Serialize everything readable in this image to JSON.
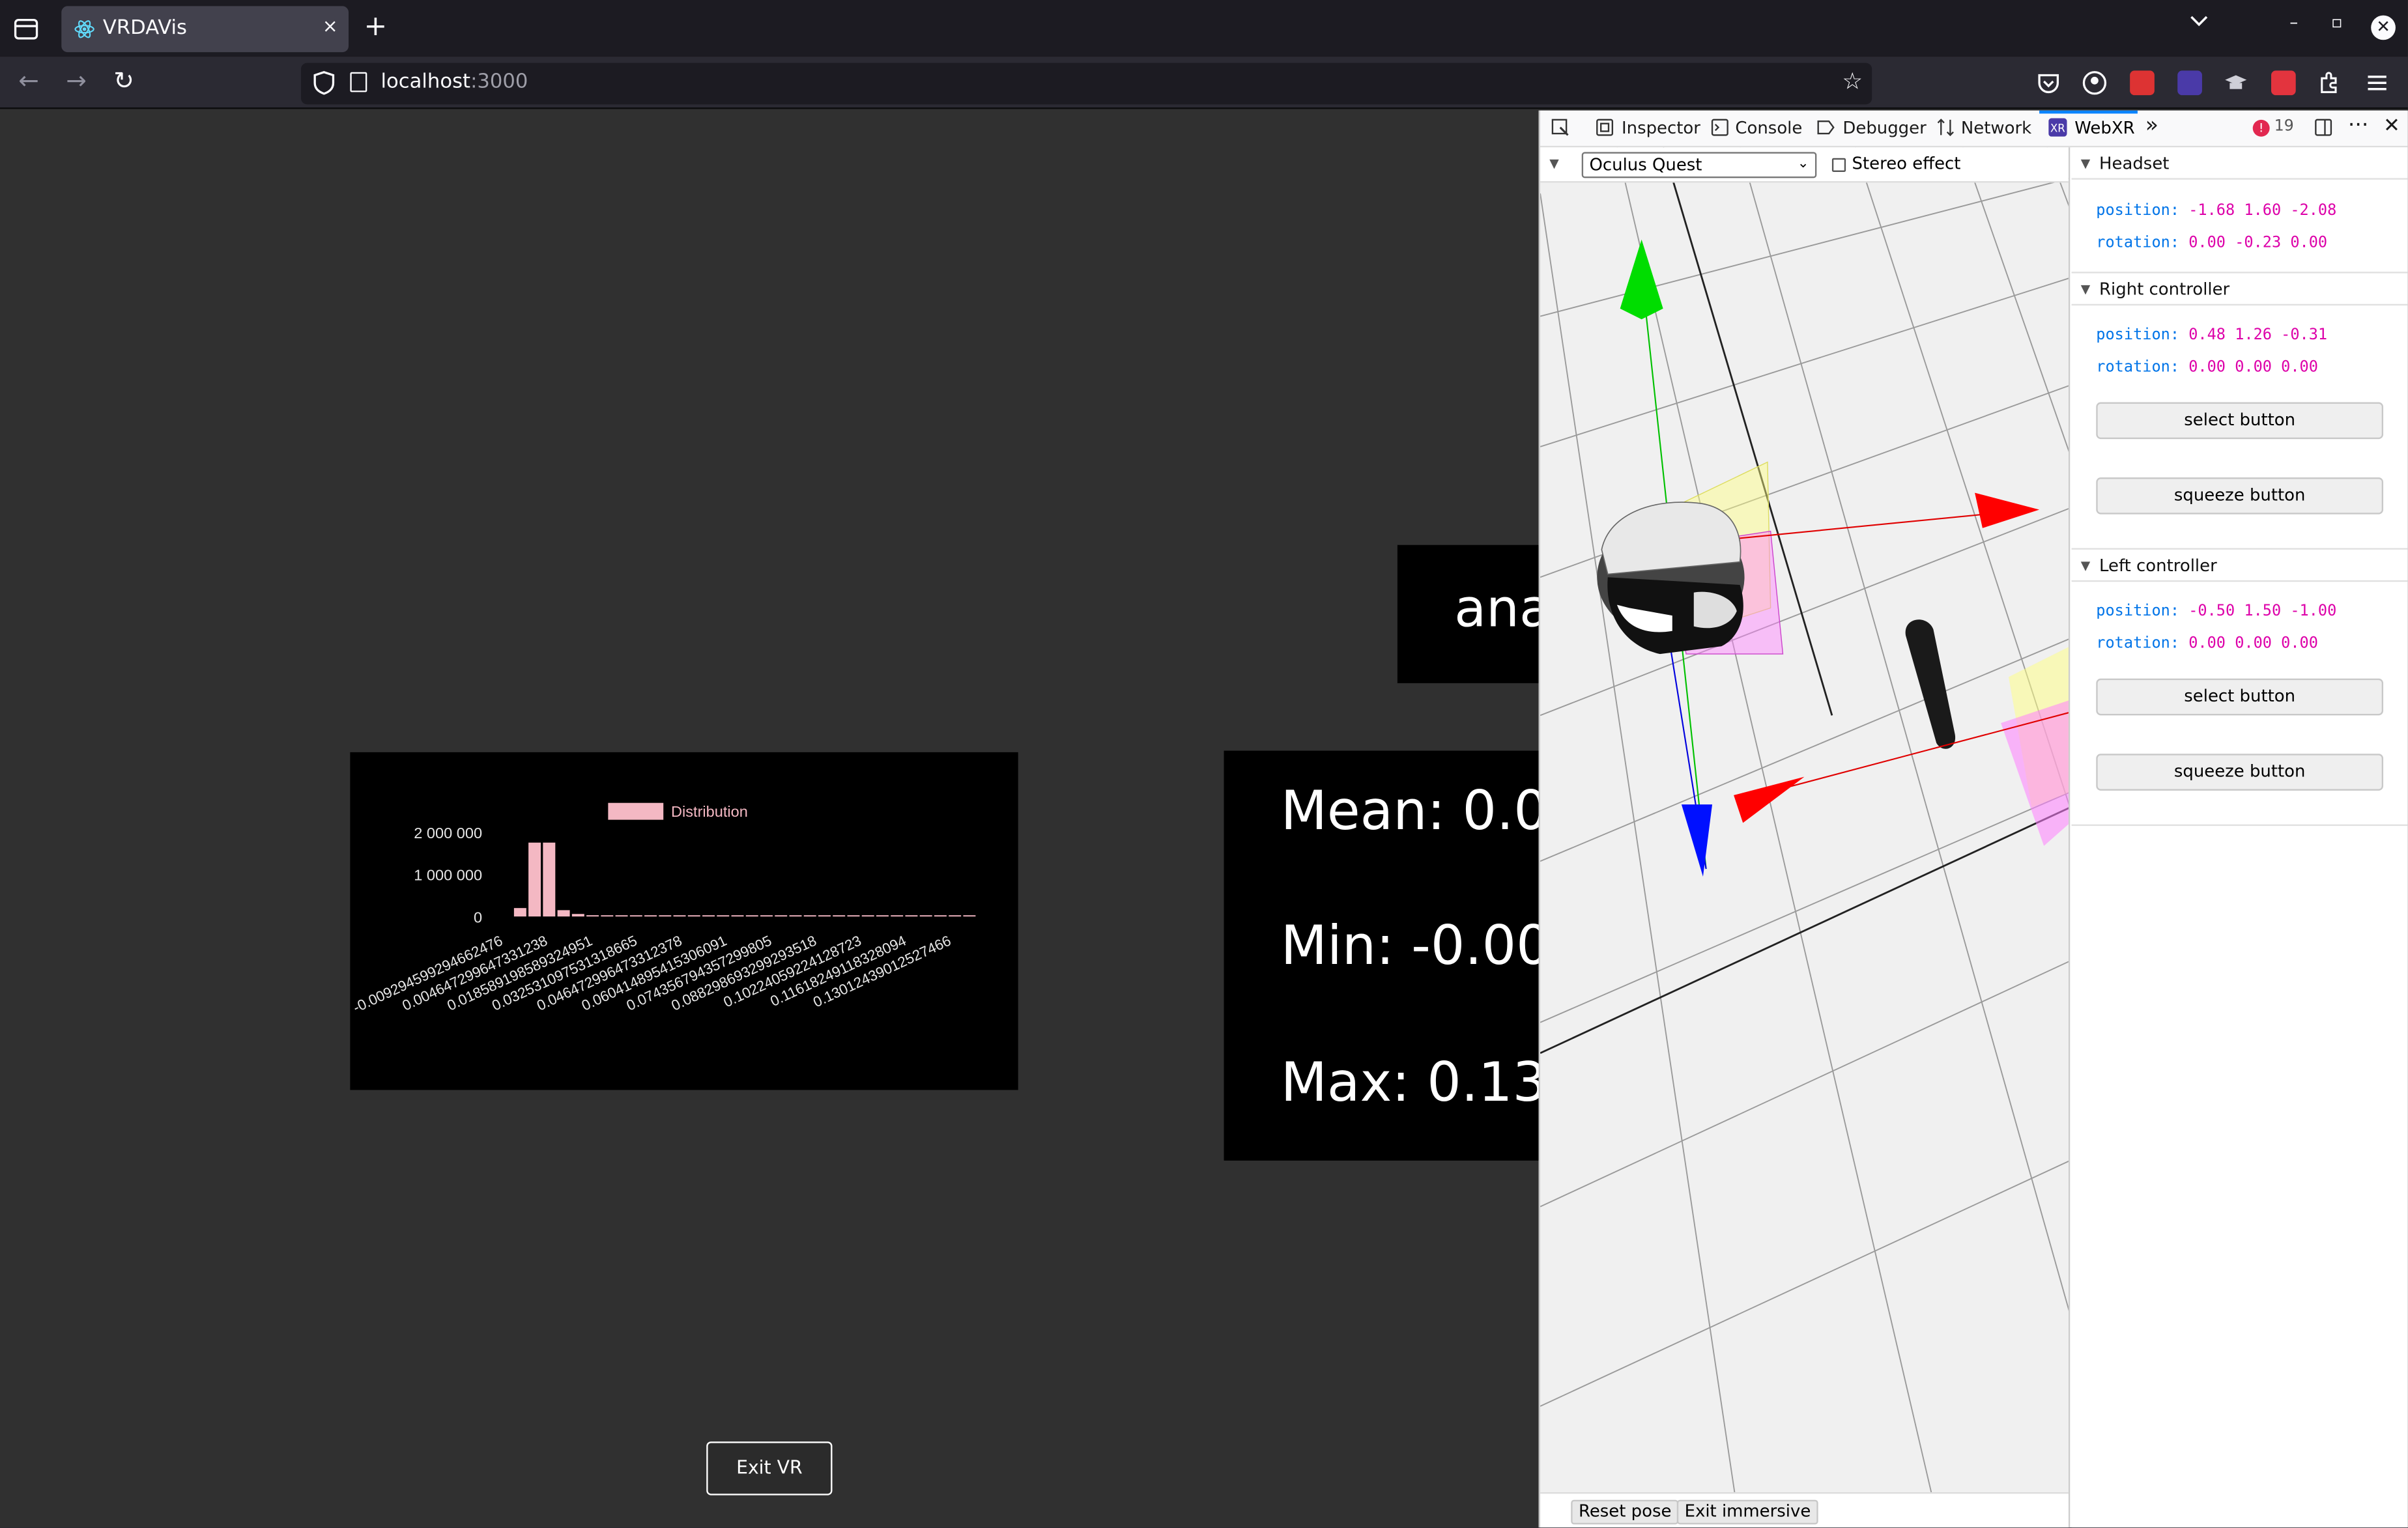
{
  "browser": {
    "tab_title": "VRDAVis",
    "tab_close": "×",
    "new_tab": "+",
    "url_host": "localhost",
    "url_port": ":3000"
  },
  "page": {
    "chart": {
      "legend": "Distribution",
      "y_ticks": [
        "2 000 000",
        "1 000 000",
        "0"
      ],
      "x_ticks": [
        "-0.009294599294662476",
        "0.004647299647331238",
        "0.018589198589324951",
        "0.032531097531318665",
        "0.046472996473312378",
        "0.060414895415306091",
        "0.074356794357299805",
        "0.088298693299293518",
        "0.10224059224128723",
        "0.11618249118328094",
        "0.13012439012527466"
      ]
    },
    "stats": {
      "mean": "Mean: 0.0",
      "min": "Min: -0.00",
      "max": "Max: 0.13"
    },
    "ana_text": "ana",
    "exit_vr": "Exit VR"
  },
  "chart_data": {
    "type": "bar",
    "title": "",
    "legend": [
      "Distribution"
    ],
    "ylim": [
      0,
      2000000
    ],
    "categories": [
      "-0.009294599294662476",
      "0.004647299647331238",
      "0.018589198589324951",
      "0.032531097531318665",
      "0.046472996473312378",
      "0.060414895415306091",
      "0.074356794357299805",
      "0.088298693299293518",
      "0.10224059224128723",
      "0.11618249118328094",
      "0.13012439012527466"
    ],
    "series": [
      {
        "name": "Distribution",
        "values": [
          200000,
          1750000,
          1750000,
          150000,
          60000,
          30000,
          15000,
          8000,
          5000,
          3000,
          2000,
          1500,
          1000,
          1000,
          800,
          800,
          600,
          600,
          500,
          500,
          400,
          400,
          300,
          300,
          300,
          200,
          200,
          200,
          200,
          150,
          150,
          100
        ]
      }
    ],
    "colors": {
      "bar": "#f4b8c3",
      "axis_text": "#e6e6e6"
    }
  },
  "devtools": {
    "tabs": [
      "Inspector",
      "Console",
      "Debugger",
      "Network",
      "WebXR"
    ],
    "active_tab": "WebXR",
    "error_count": "19",
    "device": "Oculus Quest",
    "stereo_label": "Stereo effect",
    "reset_pose": "Reset pose",
    "exit_immersive": "Exit immersive",
    "headset": {
      "title": "Headset",
      "position_label": "position:",
      "position": "-1.68 1.60 -2.08",
      "rotation_label": "rotation:",
      "rotation": "0.00 -0.23 0.00"
    },
    "right_controller": {
      "title": "Right controller",
      "position_label": "position:",
      "position": "0.48 1.26 -0.31",
      "rotation_label": "rotation:",
      "rotation": "0.00 0.00 0.00",
      "select": "select button",
      "squeeze": "squeeze button"
    },
    "left_controller": {
      "title": "Left controller",
      "position_label": "position:",
      "position": "-0.50 1.50 -1.00",
      "rotation_label": "rotation:",
      "rotation": "0.00 0.00 0.00",
      "select": "select button",
      "squeeze": "squeeze button"
    }
  }
}
